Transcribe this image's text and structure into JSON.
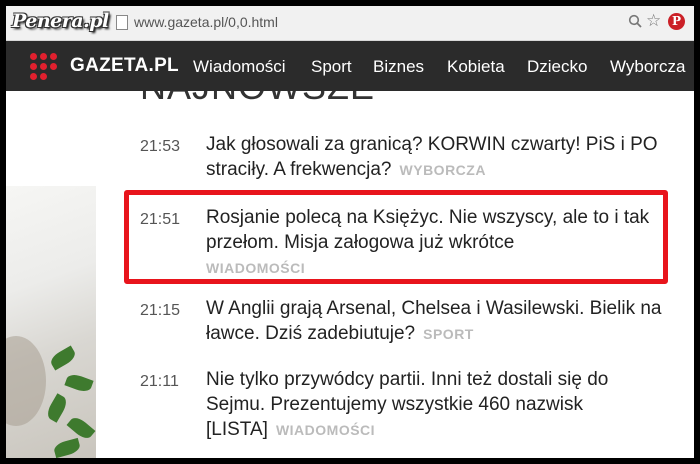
{
  "browser": {
    "watermark": "Penera.pl",
    "url": "www.gazeta.pl/0,0.html",
    "icons": [
      "page-icon",
      "zoom-icon",
      "star-icon",
      "pinterest-icon"
    ],
    "pin_glyph": "P",
    "star_glyph": "☆"
  },
  "site": {
    "logo": "GAZETA.PL",
    "nav": [
      "Wiadomości",
      "Sport",
      "Biznes",
      "Kobieta",
      "Dziecko",
      "Wyborcza"
    ],
    "accent": "#e0202e"
  },
  "section": {
    "heading": "NAJNOWSZE"
  },
  "news": [
    {
      "time": "21:53",
      "title": "Jak głosowali za granicą? KORWIN czwarty! PiS i PO straciły. A frekwencja?",
      "source": "WYBORCZA"
    },
    {
      "time": "21:51",
      "title": "Rosjanie polecą na Księżyc. Nie wszyscy, ale to i tak przełom. Misja załogowa już wkrótce",
      "source": "WIADOMOŚCI",
      "highlighted": true
    },
    {
      "time": "21:15",
      "title": "W Anglii grają Arsenal, Chelsea i Wasilewski. Bielik na ławce. Dziś zadebiutuje?",
      "source": "SPORT"
    },
    {
      "time": "21:11",
      "title": "Nie tylko przywódcy partii. Inni też dostali się do Sejmu. Prezentujemy wszystkie 460 nazwisk [LISTA]",
      "source": "WIADOMOŚCI"
    }
  ],
  "colors": {
    "highlight": "#e8141c",
    "nav_bg": "#2b2b2b",
    "source_label": "#bbbbbb"
  }
}
